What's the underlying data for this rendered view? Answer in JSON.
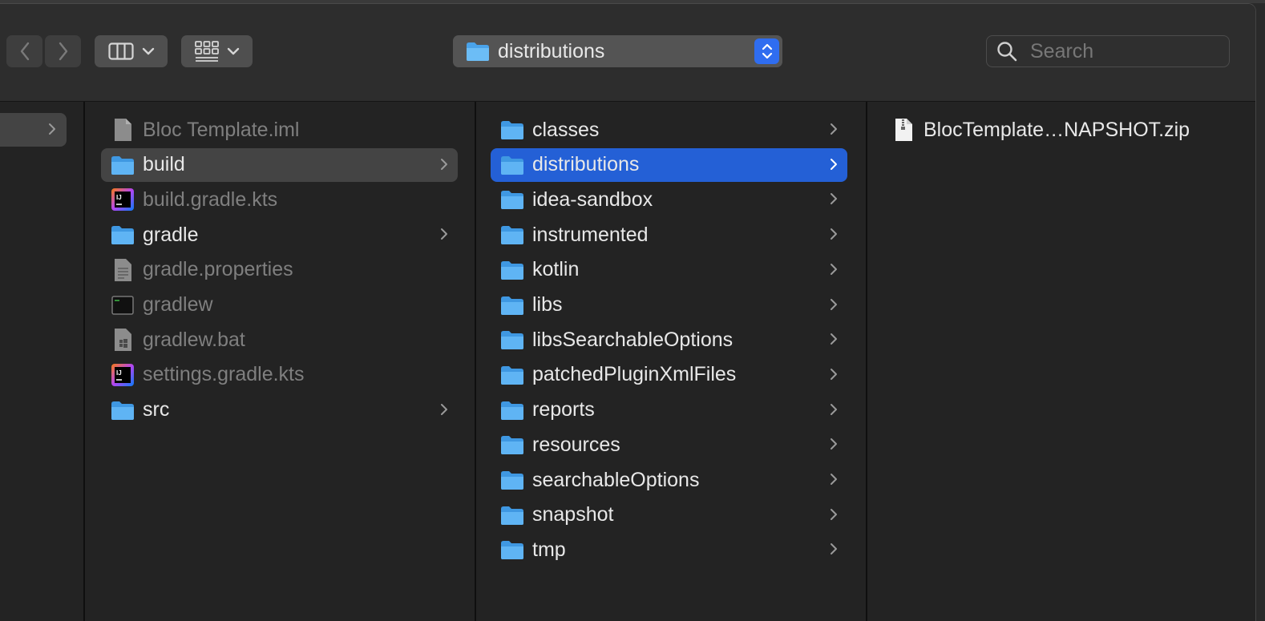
{
  "toolbar": {
    "path_title": "distributions",
    "search_placeholder": "Search"
  },
  "column2": [
    {
      "name": "Bloc Template.iml",
      "type": "file",
      "dim": true
    },
    {
      "name": "build",
      "type": "folder",
      "dim": false,
      "selected": "gray",
      "chevron": true
    },
    {
      "name": "build.gradle.kts",
      "type": "intellij",
      "dim": true
    },
    {
      "name": "gradle",
      "type": "folder",
      "dim": false,
      "chevron": true
    },
    {
      "name": "gradle.properties",
      "type": "text-file",
      "dim": true
    },
    {
      "name": "gradlew",
      "type": "terminal",
      "dim": true
    },
    {
      "name": "gradlew.bat",
      "type": "windows-file",
      "dim": true
    },
    {
      "name": "settings.gradle.kts",
      "type": "intellij",
      "dim": true
    },
    {
      "name": "src",
      "type": "folder",
      "dim": false,
      "chevron": true
    }
  ],
  "column3": [
    {
      "name": "classes"
    },
    {
      "name": "distributions",
      "selected": "blue"
    },
    {
      "name": "idea-sandbox"
    },
    {
      "name": "instrumented"
    },
    {
      "name": "kotlin"
    },
    {
      "name": "libs"
    },
    {
      "name": "libsSearchableOptions"
    },
    {
      "name": "patchedPluginXmlFiles"
    },
    {
      "name": "reports"
    },
    {
      "name": "resources"
    },
    {
      "name": "searchableOptions"
    },
    {
      "name": "snapshot"
    },
    {
      "name": "tmp"
    }
  ],
  "column4": [
    {
      "name": "BlocTemplate…NAPSHOT.zip",
      "type": "zip"
    }
  ],
  "colors": {
    "folder_blue": "#5fb4f4",
    "selection_blue": "#2460d6",
    "selection_gray": "#444444",
    "stepper_blue": "#2f6df0"
  }
}
